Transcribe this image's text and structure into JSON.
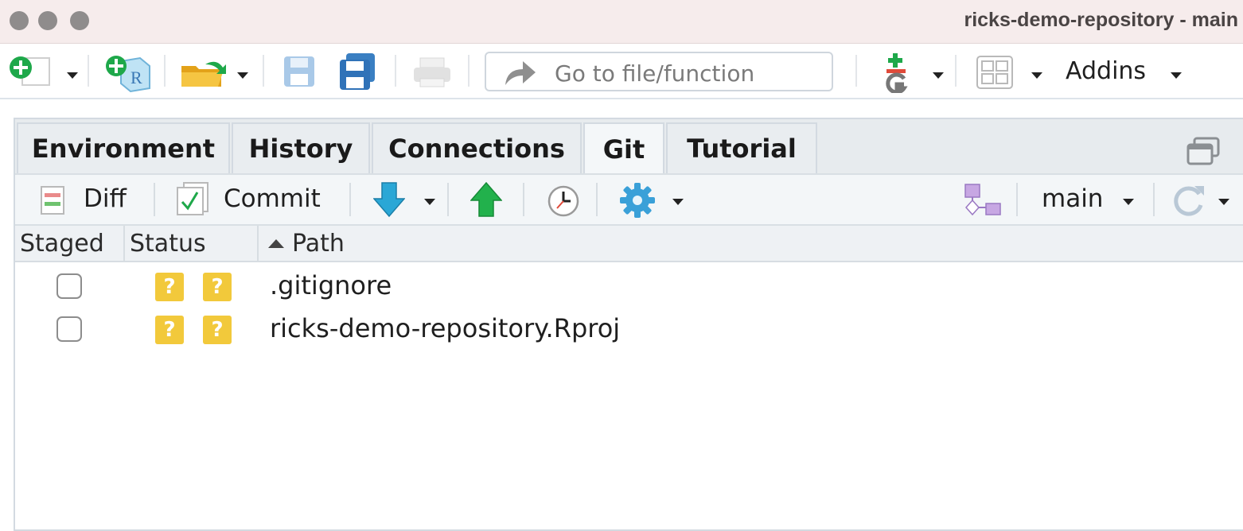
{
  "window": {
    "title": "ricks-demo-repository - main"
  },
  "toolbar": {
    "goto_placeholder": "Go to file/function",
    "addins_label": "Addins"
  },
  "tabs": [
    {
      "label": "Environment",
      "active": false
    },
    {
      "label": "History",
      "active": false
    },
    {
      "label": "Connections",
      "active": false
    },
    {
      "label": "Git",
      "active": true
    },
    {
      "label": "Tutorial",
      "active": false
    }
  ],
  "git_toolbar": {
    "diff_label": "Diff",
    "commit_label": "Commit",
    "branch": "main"
  },
  "columns": {
    "staged": "Staged",
    "status": "Status",
    "path": "Path"
  },
  "files": [
    {
      "staged": false,
      "status": [
        "?",
        "?"
      ],
      "path": ".gitignore"
    },
    {
      "staged": false,
      "status": [
        "?",
        "?"
      ],
      "path": "ricks-demo-repository.Rproj"
    }
  ],
  "colors": {
    "untracked_badge": "#f2c93b",
    "pull_arrow": "#2aa7d6",
    "push_arrow": "#22b14c"
  }
}
